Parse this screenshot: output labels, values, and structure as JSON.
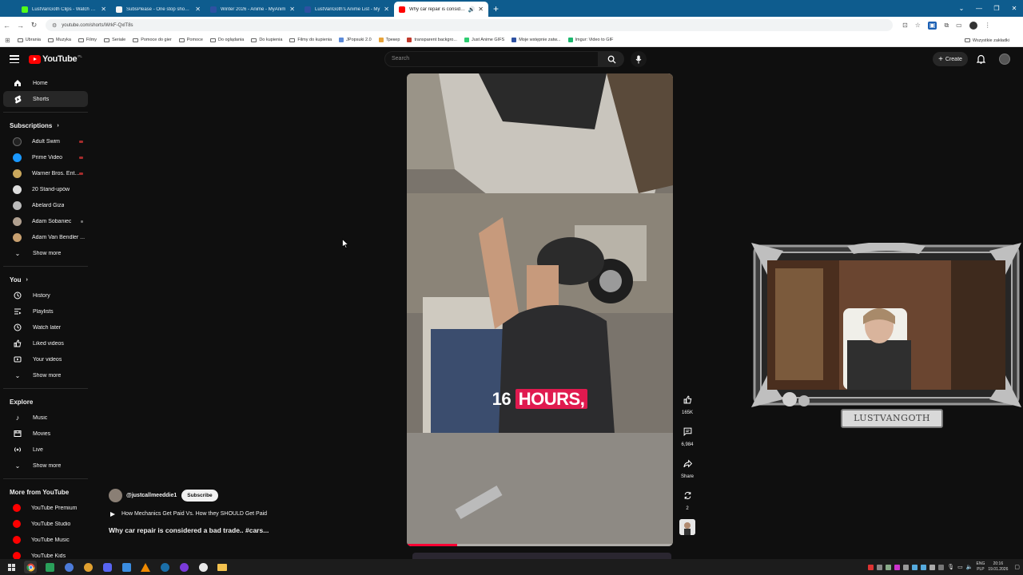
{
  "browser": {
    "tabs": [
      {
        "title": "LustVanGoth Clips - Watch Live",
        "color": "#53fc18",
        "active": false
      },
      {
        "title": "SubsPlease - One stop shop fo",
        "color": "#f4f4f4",
        "active": false
      },
      {
        "title": "Winter 2026 - Anime - MyAnim",
        "color": "#2e51a2",
        "active": false
      },
      {
        "title": "LustVanGoth's Anime List - My",
        "color": "#2e51a2",
        "active": false
      },
      {
        "title": "Why car repair is considere",
        "color": "#ff0000",
        "active": true
      }
    ],
    "url": "youtube.com/shorts/WrkF-QxlT8s",
    "bookmarks": [
      {
        "label": "Ubrania",
        "type": "folder"
      },
      {
        "label": "Muzyka",
        "type": "folder"
      },
      {
        "label": "Filmy",
        "type": "folder"
      },
      {
        "label": "Seriale",
        "type": "folder"
      },
      {
        "label": "Pomoce do gier",
        "type": "folder"
      },
      {
        "label": "Pomoce",
        "type": "folder"
      },
      {
        "label": "Do oglądania",
        "type": "folder"
      },
      {
        "label": "Do kupienia",
        "type": "folder"
      },
      {
        "label": "Filmy do kupienia",
        "type": "folder"
      },
      {
        "label": "JPopsuki 2.0",
        "type": "site",
        "color": "#5b8ad9"
      },
      {
        "label": "Трекер",
        "type": "site",
        "color": "#e7a33a"
      },
      {
        "label": "transparent backgro...",
        "type": "site",
        "color": "#c0392b"
      },
      {
        "label": "Just Anime GIFS",
        "type": "site",
        "color": "#2ecc71"
      },
      {
        "label": "Moje wstępnie zatw...",
        "type": "site",
        "color": "#2e51a2"
      },
      {
        "label": "Imgur: Video to GIF",
        "type": "site",
        "color": "#1bb76e"
      }
    ],
    "bookmarks_right": "Wszystkie zakładki"
  },
  "youtube": {
    "logo": "YouTube",
    "logo_country": "PL",
    "search_placeholder": "Search",
    "create_label": "Create",
    "sidebar": {
      "main": [
        {
          "label": "Home",
          "icon": "home-icon",
          "selected": false
        },
        {
          "label": "Shorts",
          "icon": "shorts-icon",
          "selected": true
        }
      ],
      "subscriptions_header": "Subscriptions",
      "subscriptions": [
        {
          "label": "Adult Swim",
          "color": "#222",
          "live": true
        },
        {
          "label": "Prime Video",
          "color": "#1a98ff",
          "live": true
        },
        {
          "label": "Warner Bros. Ent...",
          "color": "#c9a75c",
          "live": true
        },
        {
          "label": "20 Stand-upów",
          "color": "#ddd",
          "live": false
        },
        {
          "label": "Abelard Giza",
          "color": "#bbb",
          "live": false
        },
        {
          "label": "Adam Sobaniec",
          "color": "#b0a090",
          "live": false
        },
        {
          "label": "Adam Van Bendler ...",
          "color": "#c8a070",
          "live": false
        }
      ],
      "show_more": "Show more",
      "you_header": "You",
      "you": [
        {
          "label": "History",
          "icon": "history-icon"
        },
        {
          "label": "Playlists",
          "icon": "playlists-icon"
        },
        {
          "label": "Watch later",
          "icon": "watch-later-icon"
        },
        {
          "label": "Liked videos",
          "icon": "liked-videos-icon"
        },
        {
          "label": "Your videos",
          "icon": "your-videos-icon"
        }
      ],
      "explore_header": "Explore",
      "explore": [
        {
          "label": "Music",
          "icon": "music-icon"
        },
        {
          "label": "Movies",
          "icon": "movies-icon"
        },
        {
          "label": "Live",
          "icon": "live-icon"
        }
      ],
      "more_header": "More from YouTube",
      "more": [
        {
          "label": "YouTube Premium"
        },
        {
          "label": "YouTube Studio"
        },
        {
          "label": "YouTube Music"
        },
        {
          "label": "YouTube Kids"
        }
      ]
    },
    "short": {
      "caption_plain": "16",
      "caption_highlight": "HOURS,",
      "progress": 0.19,
      "channel": "@justcallmeeddie1",
      "subscribe_label": "Subscribe",
      "related": "How Mechanics Get Paid Vs. How they SHOULD Get Paid",
      "title": "Why car repair is considered a bad trade..  #cars...",
      "likes": "165K",
      "comments": "6,984",
      "share_label": "Share",
      "remix_count": "2"
    },
    "overlay": {
      "streamer_name": "LUSTVANGOTH"
    }
  },
  "taskbar": {
    "lang": "ENG",
    "lang2": "PLP",
    "time": "20:16",
    "date": "19.01.2026"
  }
}
